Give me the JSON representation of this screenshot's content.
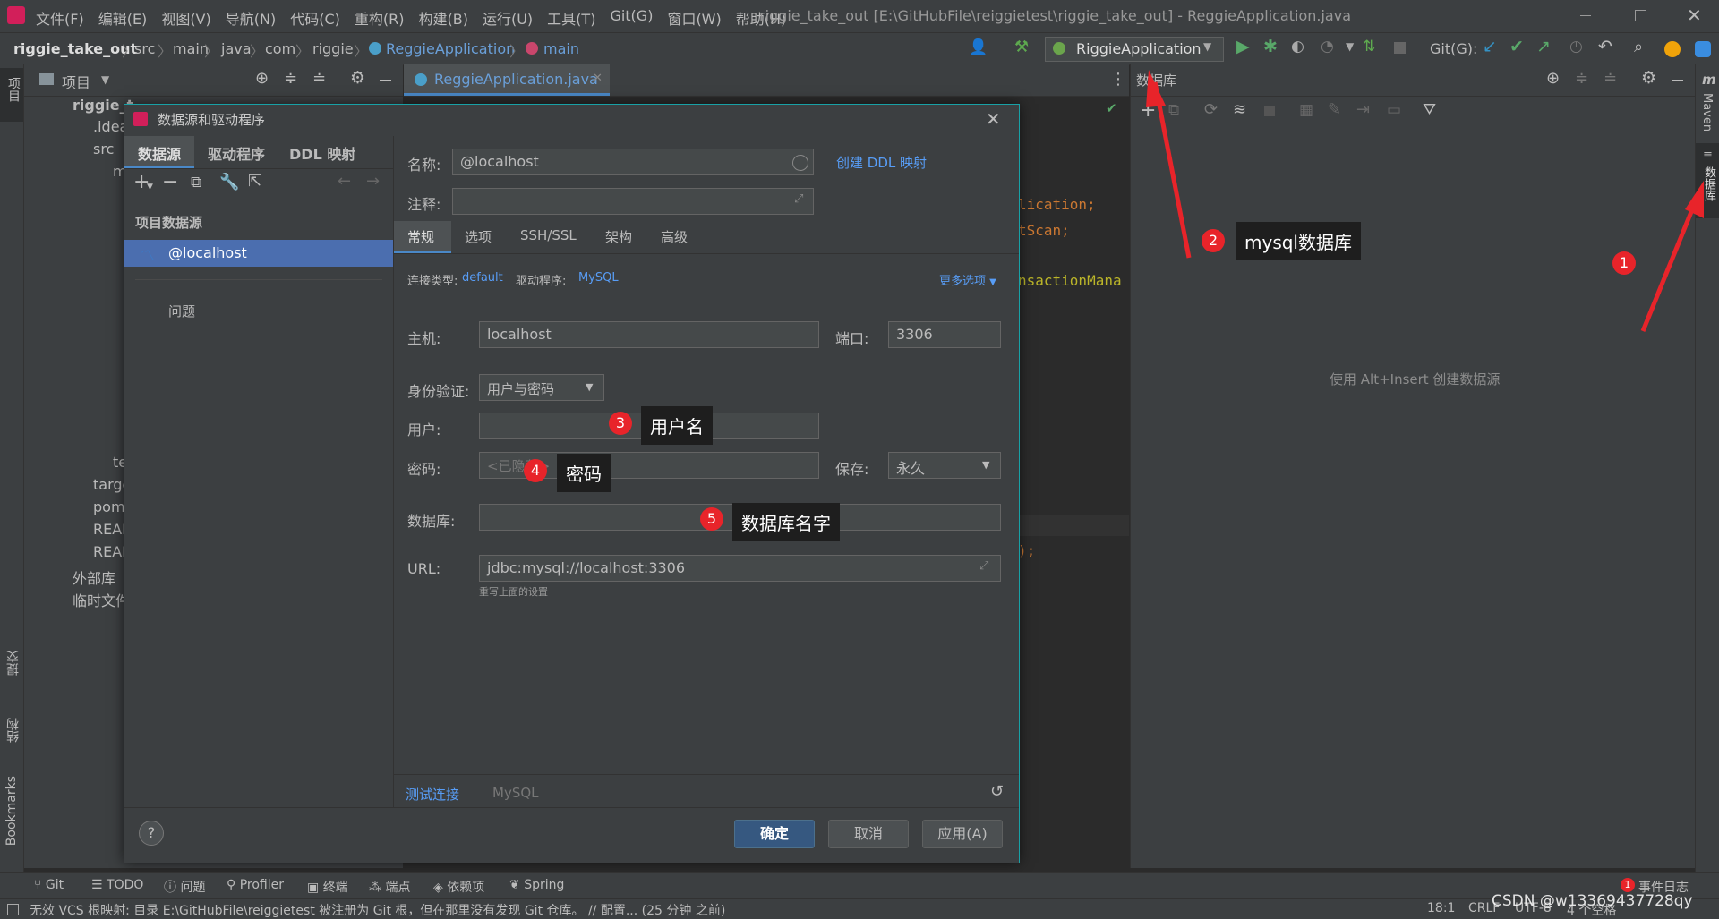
{
  "menubar": {
    "items": [
      "文件(F)",
      "编辑(E)",
      "视图(V)",
      "导航(N)",
      "代码(C)",
      "重构(R)",
      "构建(B)",
      "运行(U)",
      "工具(T)",
      "Git(G)",
      "窗口(W)",
      "帮助(H)"
    ],
    "title": "riggie_take_out [E:\\GitHubFile\\reiggietest\\riggie_take_out] - ReggieApplication.java"
  },
  "navbar": {
    "crumbs": [
      "riggie_take_out",
      "src",
      "main",
      "java",
      "com",
      "riggie",
      "ReggieApplication",
      "main"
    ],
    "run_config": "RiggieApplication",
    "git_label": "Git(G):"
  },
  "project_panel": {
    "title": "项目",
    "tree": [
      "riggie_t",
      ".idea",
      "src",
      "m",
      "te",
      "targe",
      "pom",
      "READ",
      "READ",
      "外部库",
      "临时文件"
    ]
  },
  "editor": {
    "tab_label": "ReggieApplication.java",
    "code_fragments": [
      "lication;",
      "tScan;",
      "nsactionMana",
      ");"
    ]
  },
  "database_panel": {
    "title": "数据库",
    "empty_hint": "使用 Alt+Insert 创建数据源"
  },
  "right_strip": {
    "maven": "Maven",
    "database": "数据库"
  },
  "left_strip": {
    "project": "项目",
    "commit": "提交",
    "structure": "结构",
    "bookmarks": "Bookmarks"
  },
  "dialog": {
    "title": "数据源和驱动程序",
    "left_tabs": [
      "数据源",
      "驱动程序",
      "DDL 映射"
    ],
    "section_title": "项目数据源",
    "selected_source": "@localhost",
    "problems": "问题",
    "name_label": "名称:",
    "name_value": "@localhost",
    "create_ddl_link": "创建 DDL 映射",
    "comment_label": "注释:",
    "tabs": [
      "常规",
      "选项",
      "SSH/SSL",
      "架构",
      "高级"
    ],
    "conn_type_label": "连接类型:",
    "conn_type_value": "default",
    "driver_label": "驱动程序:",
    "driver_value": "MySQL",
    "more_options": "更多选项",
    "host_label": "主机:",
    "host_value": "localhost",
    "port_label": "端口:",
    "port_value": "3306",
    "auth_label": "身份验证:",
    "auth_value": "用户与密码",
    "user_label": "用户:",
    "password_label": "密码:",
    "password_placeholder": "<已隐藏>",
    "save_label": "保存:",
    "save_value": "永久",
    "database_label": "数据库:",
    "url_label": "URL:",
    "url_value": "jdbc:mysql://localhost:3306",
    "url_hint": "重写上面的设置",
    "test_connection": "测试连接",
    "driver_footer": "MySQL",
    "ok": "确定",
    "cancel": "取消",
    "apply": "应用(A)",
    "help": "?"
  },
  "annotations": {
    "b1": "1",
    "b2": "2",
    "a2": "mysql数据库",
    "b3": "3",
    "a3": "用户名",
    "b4": "4",
    "a4": "密码",
    "b5": "5",
    "a5": "数据库名字"
  },
  "bottom_tools": [
    "Git",
    "TODO",
    "问题",
    "Profiler",
    "终端",
    "端点",
    "依赖项",
    "Spring"
  ],
  "event_log": "事件日志",
  "event_badge": "1",
  "status": {
    "message": "无效 VCS 根映射: 目录 E:\\GitHubFile\\reiggietest 被注册为 Git 根，但在那里没有发现 Git 仓库。 // 配置... (25 分钟 之前)",
    "position": "18:1",
    "line_sep": "CRLF",
    "encoding": "UTF-8",
    "indent": "4 个空格",
    "watermark": "CSDN @w13369437728qy"
  },
  "colors": {
    "accent": "#18a1a6",
    "primary_button": "#365880",
    "selection": "#4b6eaf",
    "badge": "#e8242a"
  }
}
